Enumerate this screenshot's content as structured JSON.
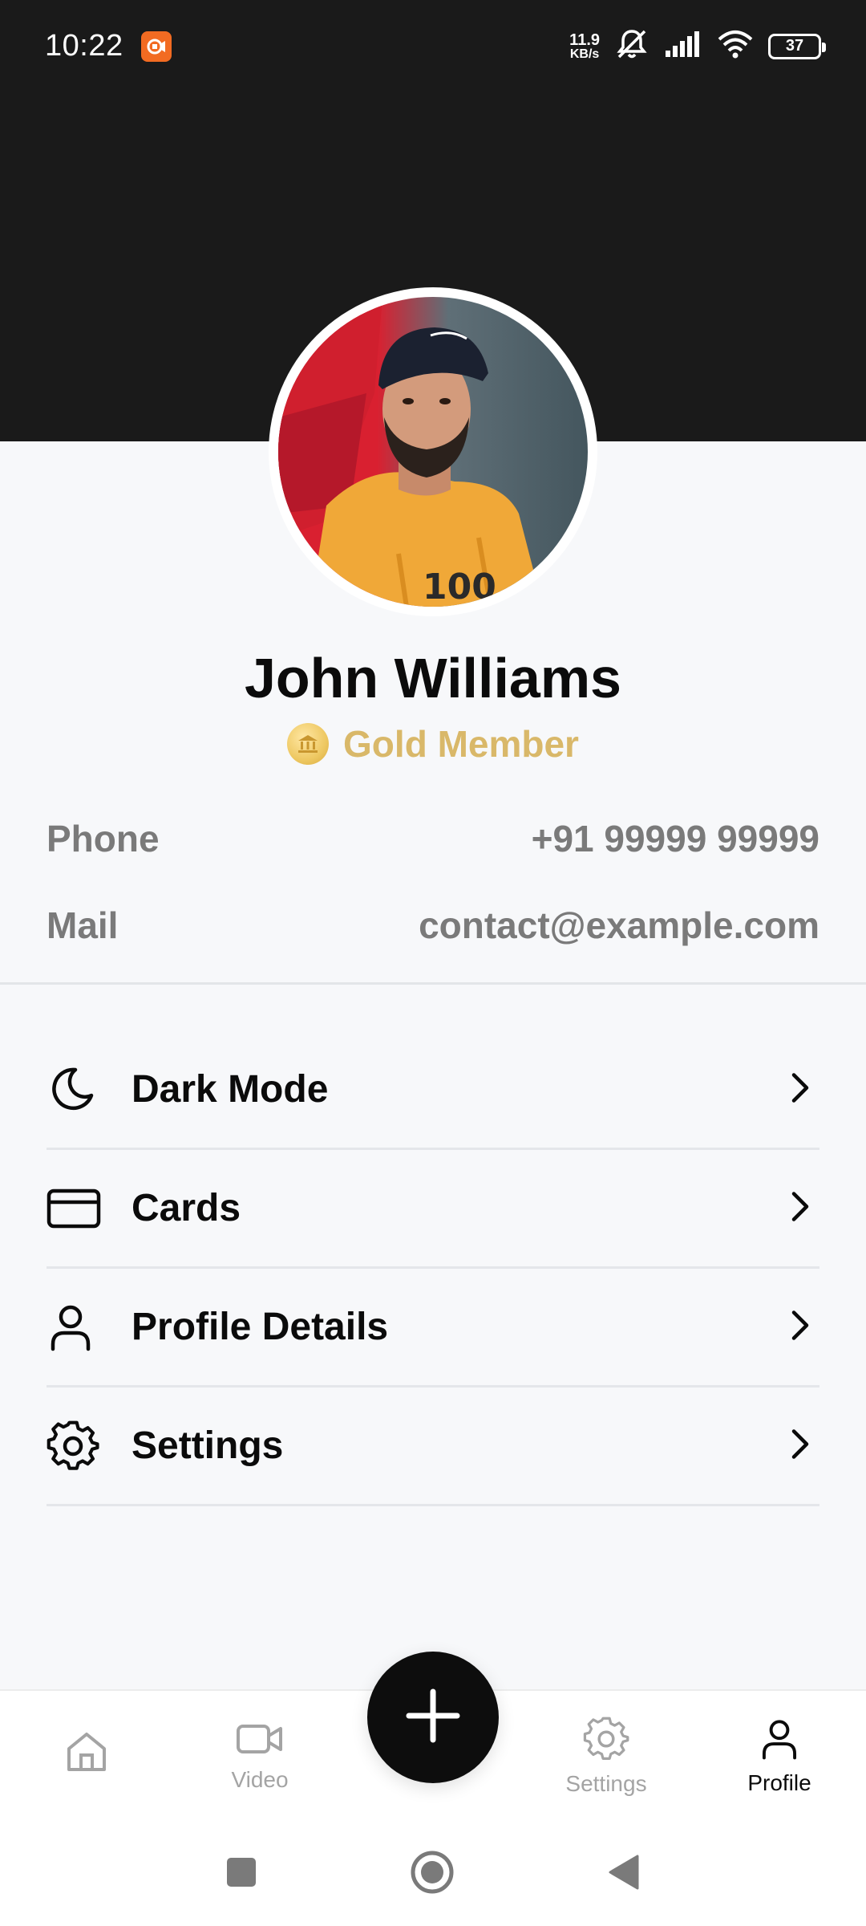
{
  "status_bar": {
    "time": "10:22",
    "net_speed_value": "11.9",
    "net_speed_unit": "KB/s",
    "battery": "37"
  },
  "profile": {
    "name": "John Williams",
    "membership": "Gold Member",
    "membership_color": "#d9b869"
  },
  "contact": {
    "phone_label": "Phone",
    "phone_value": "+91 99999 99999",
    "mail_label": "Mail",
    "mail_value": "contact@example.com"
  },
  "menu": {
    "items": [
      {
        "label": "Dark Mode",
        "icon": "moon-icon"
      },
      {
        "label": "Cards",
        "icon": "card-icon"
      },
      {
        "label": "Profile Details",
        "icon": "user-icon"
      },
      {
        "label": "Settings",
        "icon": "gear-icon"
      }
    ]
  },
  "bottom_nav": {
    "items": [
      {
        "label": "",
        "icon": "home-icon"
      },
      {
        "label": "Video",
        "icon": "video-icon"
      },
      {
        "label": "Settings",
        "icon": "gear-icon"
      },
      {
        "label": "Profile",
        "icon": "user-icon",
        "active": true
      }
    ],
    "fab_icon": "plus-icon"
  },
  "colors": {
    "header_bg": "#1a1a1a",
    "page_bg": "#f7f8fa",
    "accent_gold": "#d9b869",
    "fab_bg": "#0d0d0d"
  }
}
